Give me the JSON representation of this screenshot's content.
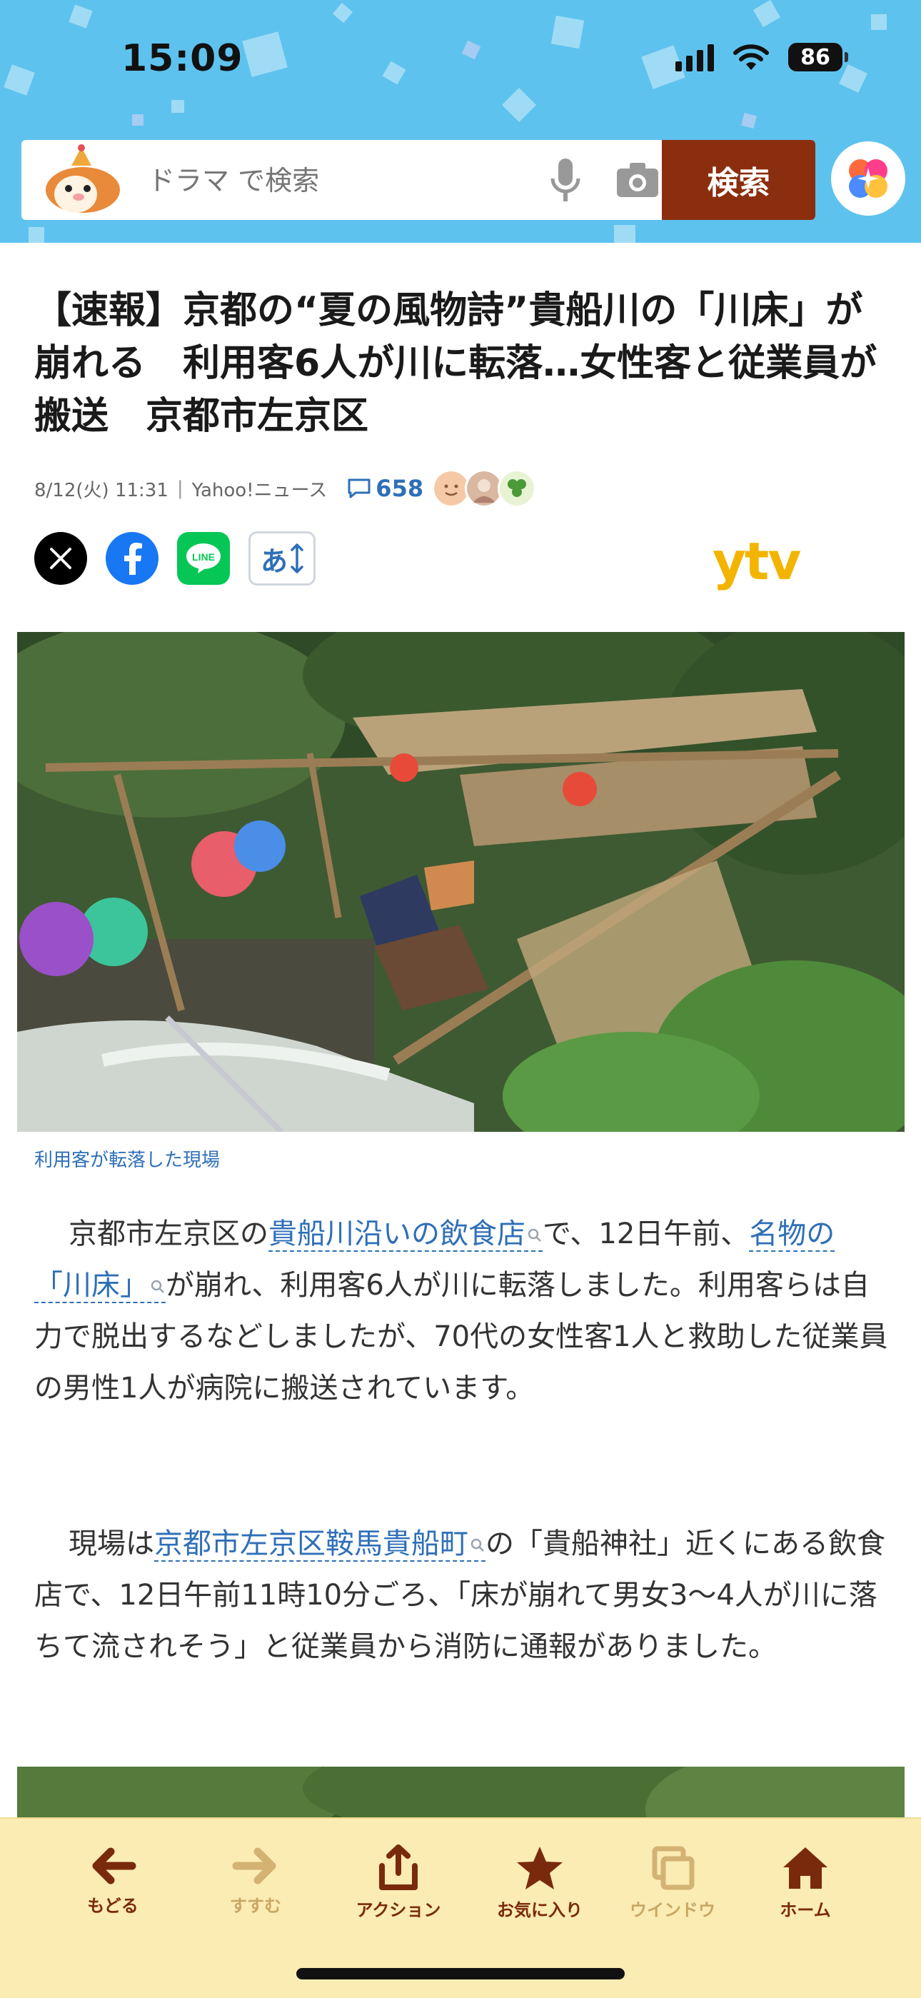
{
  "status_bar": {
    "time": "15:09",
    "battery": "86"
  },
  "search": {
    "placeholder": "ドラマ で検索",
    "button_label": "検索"
  },
  "article": {
    "headline": "【速報】京都の“夏の風物詩”貴船川の「川床」が崩れる　利用客6人が川に転落…女性客と従業員が搬送　京都市左京区",
    "date": "8/12(火) 11:31",
    "source": "Yahoo!ニュース",
    "comment_count": "658",
    "publisher_logo": "ytv",
    "font_size_button": "あ",
    "photo_caption": "利用客が転落した現場",
    "paragraph1": {
      "part1": "京都市左京区の",
      "link1": "貴船川沿いの飲食店",
      "part2": "で、12日午前、",
      "link2": "名物の「川床」",
      "part3": "が崩れ、利用客6人が川に転落しました。利用客らは自力で脱出するなどしましたが、70代の女性客1人と救助した従業員の男性1人が病院に搬送されています。"
    },
    "paragraph2": {
      "part1": "現場は",
      "link1": "京都市左京区鞍馬貴船町",
      "part2": "の「貴船神社」近くにある飲食店で、12日午前11時10分ごろ、「床が崩れて男女3〜4人が川に落ちて流されそう」と従業員から消防に通報がありました。"
    }
  },
  "toolbar": {
    "back": "もどる",
    "forward": "すすむ",
    "action": "アクション",
    "favorites": "お気に入り",
    "window": "ウインドウ",
    "home": "ホーム"
  },
  "colors": {
    "header_bg": "#5ec2ee",
    "search_button": "#8b2e0e",
    "link": "#2f6fb8",
    "toolbar_bg": "#fbecb3",
    "toolbar_active": "#7a2a0c",
    "toolbar_inactive": "#c8a765",
    "ytv_yellow": "#f3b400"
  }
}
